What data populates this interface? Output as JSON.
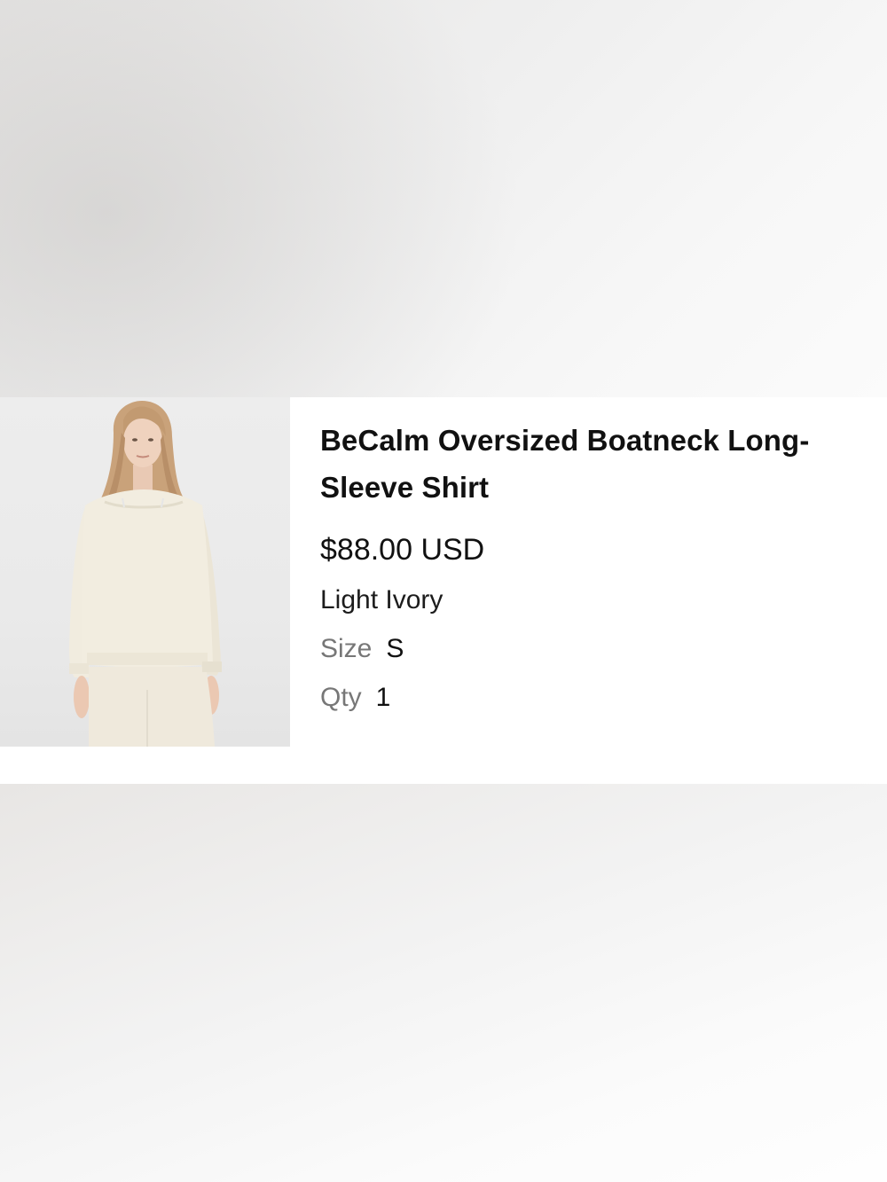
{
  "product": {
    "name": "BeCalm Oversized Boatneck Long-Sleeve Shirt",
    "price": "$88.00 USD",
    "color": "Light Ivory",
    "size_label": "Size",
    "size_value": "S",
    "qty_label": "Qty",
    "qty_value": "1",
    "image_alt": "woman wearing ivory oversized boatneck long-sleeve shirt"
  },
  "colors": {
    "background": "#ededed",
    "card": "#ffffff",
    "text": "#111111",
    "muted": "#777777",
    "garment": "#f1ecdf"
  }
}
